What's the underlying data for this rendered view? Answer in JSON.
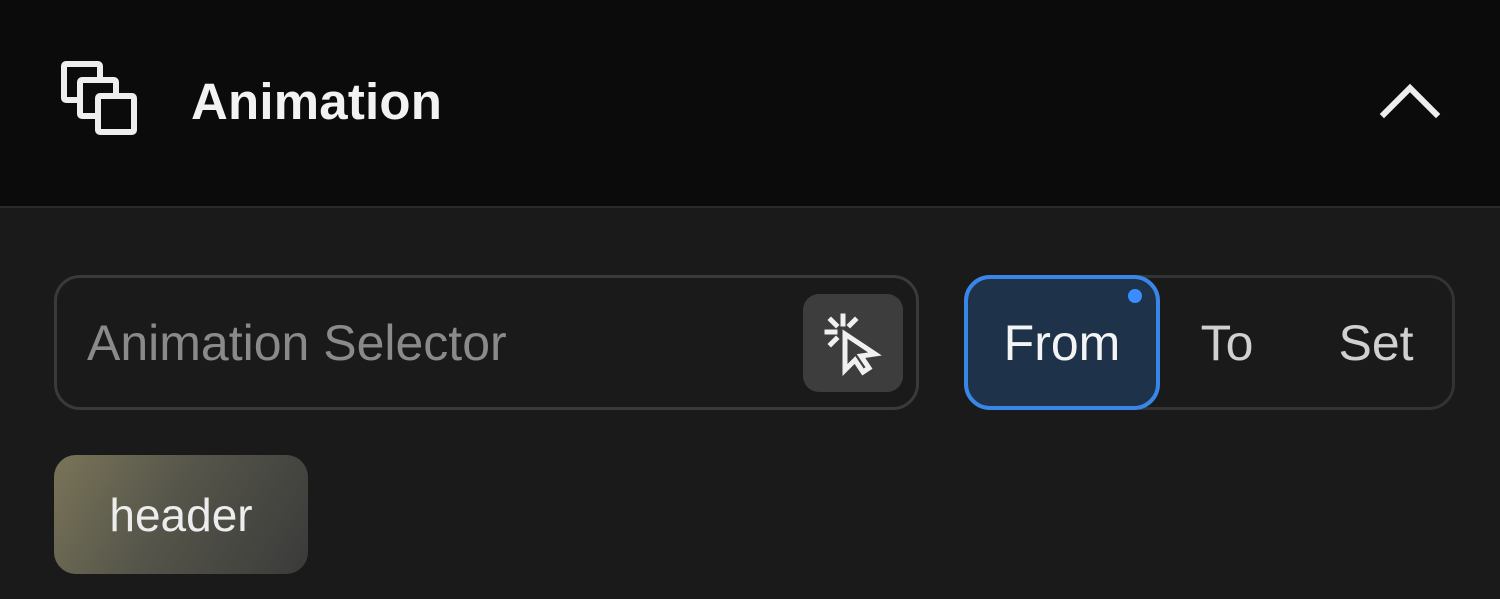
{
  "panel": {
    "title": "Animation",
    "icons": {
      "header": "layers-icon",
      "collapse": "chevron-up-icon",
      "picker": "element-picker-icon"
    }
  },
  "selector": {
    "placeholder": "Animation Selector",
    "value": ""
  },
  "modes": {
    "items": [
      "From",
      "To",
      "Set"
    ],
    "selected": "From"
  },
  "tags": [
    "header"
  ],
  "colors": {
    "header_bg": "#0b0b0b",
    "panel_bg": "#1a1a1a",
    "accent": "#3a86e8",
    "active_bg": "#1e324a"
  }
}
